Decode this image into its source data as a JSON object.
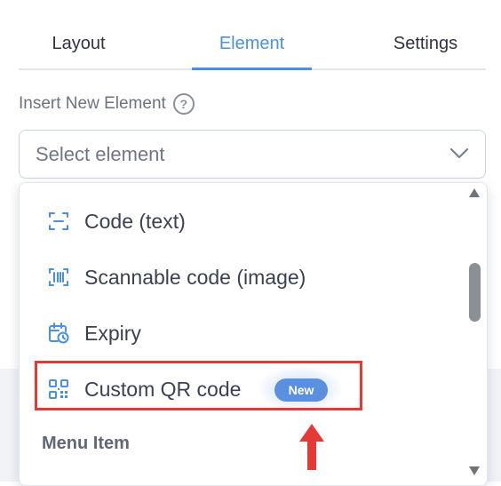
{
  "tabs": [
    {
      "label": "Layout",
      "active": false
    },
    {
      "label": "Element",
      "active": true
    },
    {
      "label": "Settings",
      "active": false
    }
  ],
  "insert_section": {
    "label": "Insert New Element",
    "help_icon": "question-circle-icon",
    "help_glyph": "?"
  },
  "select": {
    "placeholder": "Select element",
    "chevron_icon": "chevron-down-icon"
  },
  "dropdown": {
    "items": [
      {
        "label": "Code (text)",
        "icon": "code-text-icon"
      },
      {
        "label": "Scannable code (image)",
        "icon": "barcode-icon"
      },
      {
        "label": "Expiry",
        "icon": "calendar-clock-icon"
      },
      {
        "label": "Custom QR code",
        "icon": "qr-code-icon",
        "badge": "New"
      }
    ],
    "group_heading": "Menu Item"
  },
  "colors": {
    "accent": "#4a90e2",
    "badge": "#5b8fe0",
    "highlight": "#e53935"
  }
}
